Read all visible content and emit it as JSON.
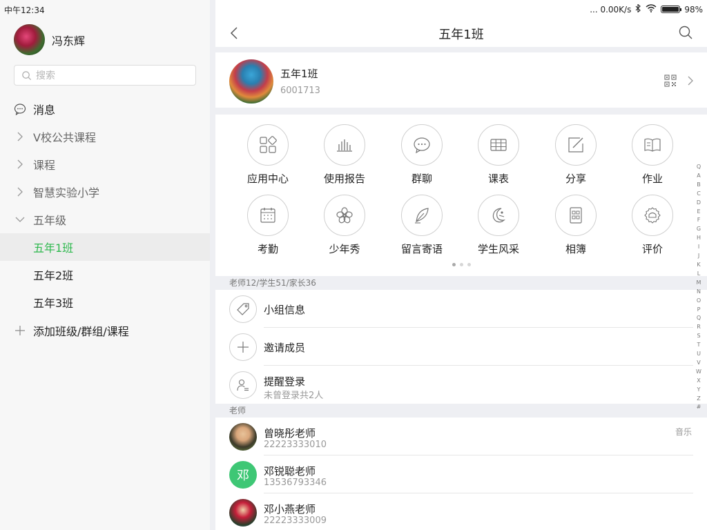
{
  "status": {
    "time": "中午12:34",
    "network": "... 0.00K/s",
    "battery": "98%",
    "battery_level": 0.98
  },
  "left": {
    "user_name": "冯东辉",
    "search_placeholder": "搜索",
    "nav": [
      {
        "label": "消息",
        "icon": "chat-icon"
      },
      {
        "label": "V校公共课程",
        "icon": "chevron-right-icon"
      },
      {
        "label": "课程",
        "icon": "chevron-right-icon"
      },
      {
        "label": "智慧实验小学",
        "icon": "chevron-right-icon"
      },
      {
        "label": "五年级",
        "icon": "chevron-down-icon"
      },
      {
        "label": "五年1班",
        "active": true
      },
      {
        "label": "五年2班"
      },
      {
        "label": "五年3班"
      },
      {
        "label": "添加班级/群组/课程",
        "icon": "plus-icon"
      }
    ]
  },
  "header": {
    "title": "五年1班"
  },
  "class_card": {
    "name": "五年1班",
    "id": "6001713"
  },
  "features": [
    {
      "label": "应用中心",
      "icon": "apps-icon"
    },
    {
      "label": "使用报告",
      "icon": "bar-chart-icon"
    },
    {
      "label": "群聊",
      "icon": "chat-bubble-icon"
    },
    {
      "label": "课表",
      "icon": "timetable-icon"
    },
    {
      "label": "分享",
      "icon": "share-edit-icon"
    },
    {
      "label": "作业",
      "icon": "book-icon"
    },
    {
      "label": "考勤",
      "icon": "calendar-icon"
    },
    {
      "label": "少年秀",
      "icon": "flower-icon"
    },
    {
      "label": "留言寄语",
      "icon": "feather-icon"
    },
    {
      "label": "学生风采",
      "icon": "moon-person-icon"
    },
    {
      "label": "相簿",
      "icon": "album-icon"
    },
    {
      "label": "评价",
      "icon": "medal-icon"
    }
  ],
  "pager": {
    "pages": 3,
    "current": 0
  },
  "members_section": {
    "header": "老师12/学生51/家长36",
    "rows": [
      {
        "title": "小组信息",
        "icon": "tag-icon"
      },
      {
        "title": "邀请成员",
        "icon": "plus-icon"
      },
      {
        "title": "提醒登录",
        "subtitle": "未曾登录共2人",
        "icon": "person-list-icon"
      }
    ]
  },
  "teachers_section": {
    "header": "老师",
    "rows": [
      {
        "name": "曾晓彤老师",
        "phone": "22223333010",
        "tag": "音乐",
        "avatar": "photo"
      },
      {
        "name": "邓锐聪老师",
        "phone": "13536793346",
        "avatar_letter": "邓"
      },
      {
        "name": "邓小燕老师",
        "phone": "22223333009",
        "avatar": "photo"
      }
    ]
  },
  "alpha_index": [
    "Q",
    "A",
    "B",
    "C",
    "D",
    "E",
    "F",
    "G",
    "H",
    "I",
    "J",
    "K",
    "L",
    "M",
    "N",
    "O",
    "P",
    "Q",
    "R",
    "S",
    "T",
    "U",
    "V",
    "W",
    "X",
    "Y",
    "Z",
    "#"
  ],
  "colors": {
    "accent": "#2db84d",
    "avatar_green": "#3ec775",
    "band": "#eeeff3"
  }
}
